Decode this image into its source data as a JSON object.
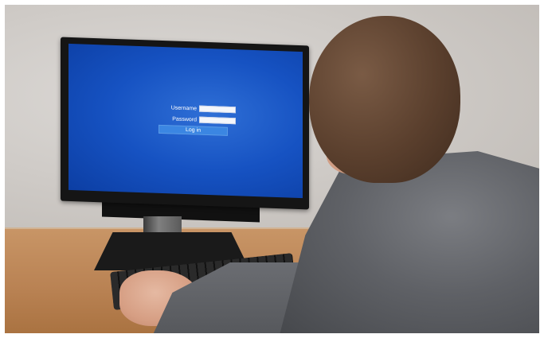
{
  "login_screen": {
    "username_label": "Username",
    "password_label": "Password",
    "login_button": "Log in"
  },
  "colors": {
    "screen_blue": "#1652c2",
    "login_button": "#3b86e2",
    "hoodie_gray": "#5f6166",
    "desk_wood": "#b98253"
  }
}
